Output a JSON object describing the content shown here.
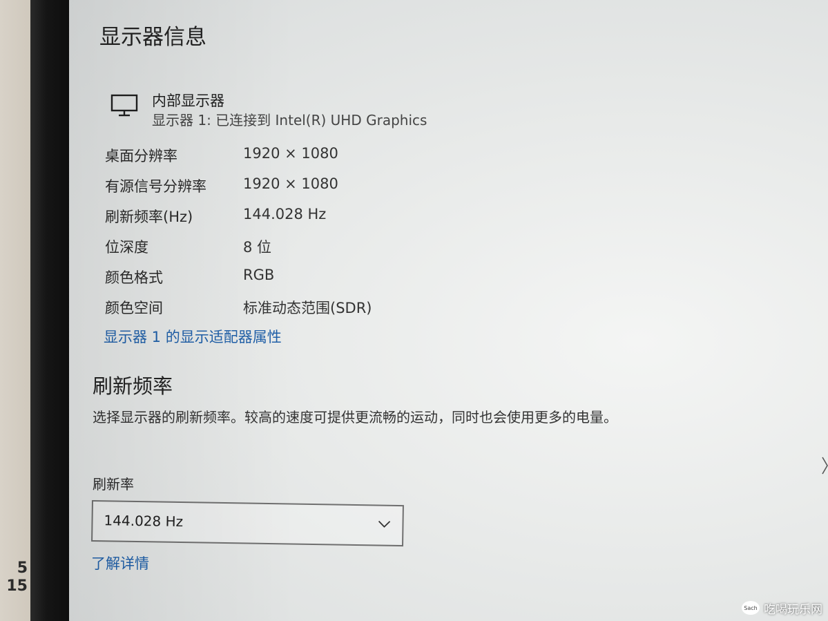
{
  "display_info": {
    "heading": "显示器信息",
    "monitor": {
      "icon": "monitor-icon",
      "name": "内部显示器",
      "connection": "显示器 1: 已连接到 Intel(R) UHD Graphics"
    },
    "properties": [
      {
        "label": "桌面分辨率",
        "value": "1920 × 1080"
      },
      {
        "label": "有源信号分辨率",
        "value": "1920 × 1080"
      },
      {
        "label": "刷新频率(Hz)",
        "value": "144.028 Hz"
      },
      {
        "label": "位深度",
        "value": "8 位"
      },
      {
        "label": "颜色格式",
        "value": "RGB"
      },
      {
        "label": "颜色空间",
        "value": "标准动态范围(SDR)"
      }
    ],
    "adapter_link": "显示器 1 的显示适配器属性"
  },
  "refresh_rate": {
    "heading": "刷新频率",
    "description": "选择显示器的刷新频率。较高的速度可提供更流畅的运动，同时也会使用更多的电量。",
    "label": "刷新率",
    "selected": "144.028 Hz",
    "learn_more": "了解详情"
  },
  "surroundings": {
    "paper_digits": [
      "5",
      "15"
    ],
    "watermark": "吃喝玩乐网",
    "watermark_logo": "Sach"
  },
  "colors": {
    "link": "#1f5fa8",
    "text": "#222222",
    "screen_bg": "#eceeed"
  }
}
